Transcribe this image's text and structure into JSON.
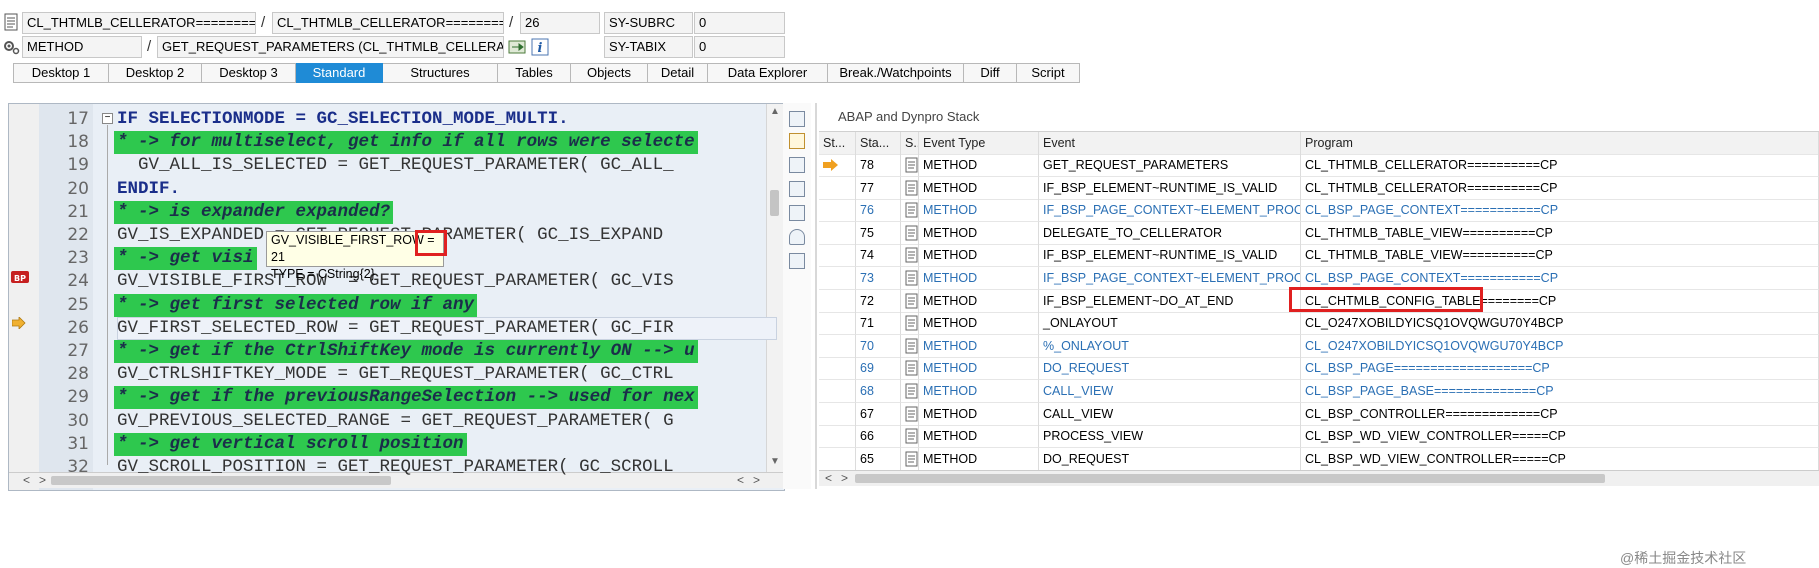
{
  "header": {
    "row1": {
      "program": "CL_THTMLB_CELLERATOR==========",
      "include": "CL_THTMLB_CELLERATOR==========",
      "line": "26",
      "sysvar": "SY-SUBRC",
      "sysval": "0"
    },
    "row2": {
      "event_type": "METHOD",
      "event": "GET_REQUEST_PARAMETERS (CL_THTMLB_CELLERAT...",
      "sysvar": "SY-TABIX",
      "sysval": "0"
    },
    "slash": "/"
  },
  "tabs": [
    {
      "label": "Desktop 1",
      "active": false
    },
    {
      "label": "Desktop 2",
      "active": false
    },
    {
      "label": "Desktop 3",
      "active": false
    },
    {
      "label": "Standard",
      "active": true
    },
    {
      "label": "Structures",
      "active": false
    },
    {
      "label": "Tables",
      "active": false
    },
    {
      "label": "Objects",
      "active": false
    },
    {
      "label": "Detail",
      "active": false
    },
    {
      "label": "Data Explorer",
      "active": false
    },
    {
      "label": "Break./Watchpoints",
      "active": false
    },
    {
      "label": "Diff",
      "active": false
    },
    {
      "label": "Script",
      "active": false
    }
  ],
  "code": [
    {
      "n": "17",
      "text": "IF SELECTIONMODE = GC_SELECTION_MODE_MULTI.",
      "type": "kw"
    },
    {
      "n": "18",
      "text": "* -> for multiselect, get info if all rows were selecte",
      "type": "cm"
    },
    {
      "n": "19",
      "text": "  GV_ALL_IS_SELECTED = GET_REQUEST_PARAMETER( GC_ALL_",
      "type": "code"
    },
    {
      "n": "20",
      "text": "ENDIF.",
      "type": "kw"
    },
    {
      "n": "21",
      "text": "* -> is expander expanded?",
      "type": "cm"
    },
    {
      "n": "22",
      "text": "GV_IS_EXPANDED = GET_REQUEST_PARAMETER( GC_IS_EXPAND",
      "type": "code"
    },
    {
      "n": "23",
      "text": "* -> get visi",
      "type": "cm"
    },
    {
      "n": "24",
      "text": "GV_VISIBLE_FIRST_ROW  = GET_REQUEST_PARAMETER( GC_VIS",
      "type": "code"
    },
    {
      "n": "25",
      "text": "* -> get first selected row if any",
      "type": "cm"
    },
    {
      "n": "26",
      "text": "GV_FIRST_SELECTED_ROW = GET_REQUEST_PARAMETER( GC_FIR",
      "type": "cur"
    },
    {
      "n": "27",
      "text": "* -> get if the CtrlShiftKey mode is currently ON --> u",
      "type": "cm"
    },
    {
      "n": "28",
      "text": "GV_CTRLSHIFTKEY_MODE = GET_REQUEST_PARAMETER( GC_CTRL",
      "type": "code"
    },
    {
      "n": "29",
      "text": "* -> get if the previousRangeSelection --> used for nex",
      "type": "cm"
    },
    {
      "n": "30",
      "text": "GV_PREVIOUS_SELECTED_RANGE = GET_REQUEST_PARAMETER( G",
      "type": "code"
    },
    {
      "n": "31",
      "text": "* -> get vertical scroll position",
      "type": "cm"
    },
    {
      "n": "32",
      "text": "GV_SCROLL_POSITION = GET_REQUEST_PARAMETER( GC_SCROLL",
      "type": "code"
    }
  ],
  "tooltip": {
    "line1_label": "GV_VISIBLE_FIRST_ROW = ",
    "line1_value": "21",
    "line2": "TYPE = CString{2}"
  },
  "stack": {
    "title": "ABAP and Dynpro Stack",
    "columns": [
      "St...",
      "Sta...",
      "S...",
      "Event Type",
      "Event",
      "Program"
    ],
    "rows": [
      {
        "level": "78",
        "type": "METHOD",
        "event": "GET_REQUEST_PARAMETERS",
        "program": "CL_THTMLB_CELLERATOR==========CP",
        "blue": false,
        "current": true
      },
      {
        "level": "77",
        "type": "METHOD",
        "event": "IF_BSP_ELEMENT~RUNTIME_IS_VALID",
        "program": "CL_THTMLB_CELLERATOR==========CP",
        "blue": false,
        "current": false
      },
      {
        "level": "76",
        "type": "METHOD",
        "event": "IF_BSP_PAGE_CONTEXT~ELEMENT_PROC...",
        "program": "CL_BSP_PAGE_CONTEXT===========CP",
        "blue": true,
        "current": false
      },
      {
        "level": "75",
        "type": "METHOD",
        "event": "DELEGATE_TO_CELLERATOR",
        "program": "CL_THTMLB_TABLE_VIEW==========CP",
        "blue": false,
        "current": false
      },
      {
        "level": "74",
        "type": "METHOD",
        "event": "IF_BSP_ELEMENT~RUNTIME_IS_VALID",
        "program": "CL_THTMLB_TABLE_VIEW==========CP",
        "blue": false,
        "current": false
      },
      {
        "level": "73",
        "type": "METHOD",
        "event": "IF_BSP_PAGE_CONTEXT~ELEMENT_PROC...",
        "program": "CL_BSP_PAGE_CONTEXT===========CP",
        "blue": true,
        "current": false
      },
      {
        "level": "72",
        "type": "METHOD",
        "event": "IF_BSP_ELEMENT~DO_AT_END",
        "program": "CL_CHTMLB_CONFIG_TABLE========CP",
        "blue": false,
        "current": false
      },
      {
        "level": "71",
        "type": "METHOD",
        "event": "_ONLAYOUT",
        "program": "CL_O247XOBILDYICSQ1OVQWGU70Y4BCP",
        "blue": false,
        "current": false
      },
      {
        "level": "70",
        "type": "METHOD",
        "event": "%_ONLAYOUT",
        "program": "CL_O247XOBILDYICSQ1OVQWGU70Y4BCP",
        "blue": true,
        "current": false
      },
      {
        "level": "69",
        "type": "METHOD",
        "event": "DO_REQUEST",
        "program": "CL_BSP_PAGE===================CP",
        "blue": true,
        "current": false
      },
      {
        "level": "68",
        "type": "METHOD",
        "event": "CALL_VIEW",
        "program": "CL_BSP_PAGE_BASE==============CP",
        "blue": true,
        "current": false
      },
      {
        "level": "67",
        "type": "METHOD",
        "event": "CALL_VIEW",
        "program": "CL_BSP_CONTROLLER=============CP",
        "blue": false,
        "current": false
      },
      {
        "level": "66",
        "type": "METHOD",
        "event": "PROCESS_VIEW",
        "program": "CL_BSP_WD_VIEW_CONTROLLER=====CP",
        "blue": false,
        "current": false
      },
      {
        "level": "65",
        "type": "METHOD",
        "event": "DO_REQUEST",
        "program": "CL_BSP_WD_VIEW_CONTROLLER=====CP",
        "blue": false,
        "current": false
      }
    ]
  },
  "watermark": "@稀土掘金技术社区",
  "colors": {
    "tab_active": "#1f8bd6",
    "comment_bg": "#2ec84e",
    "highlight": "#e02020",
    "link": "#2a6fb4"
  }
}
